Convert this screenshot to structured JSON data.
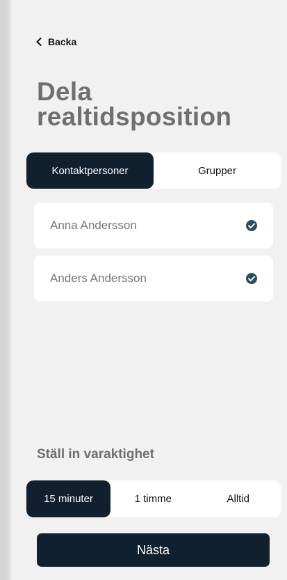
{
  "nav": {
    "back_label": "Backa"
  },
  "header": {
    "title": "Dela realtidsposition"
  },
  "tabs": [
    {
      "label": "Kontaktpersoner",
      "active": true
    },
    {
      "label": "Grupper",
      "active": false
    }
  ],
  "contacts": [
    {
      "name": "Anna Andersson",
      "selected": true
    },
    {
      "name": "Anders Andersson",
      "selected": true
    }
  ],
  "duration": {
    "label": "Ställ in varaktighet",
    "options": [
      {
        "label": "15 minuter",
        "active": true
      },
      {
        "label": "1 timme",
        "active": false
      },
      {
        "label": "Alltid",
        "active": false
      }
    ]
  },
  "actions": {
    "next_label": "Nästa"
  },
  "colors": {
    "primary": "#10202e",
    "check": "#2d4d5e",
    "background": "#f1f1f1",
    "muted_text": "#6f6f6f"
  }
}
